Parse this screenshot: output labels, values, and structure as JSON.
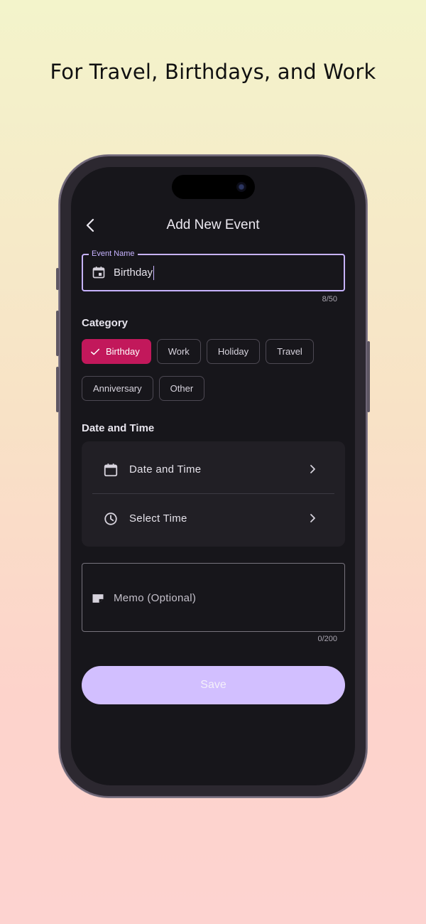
{
  "headline": "For Travel, Birthdays, and Work",
  "nav": {
    "title": "Add New Event",
    "back_icon": "chevron-left-icon"
  },
  "event_name": {
    "label": "Event Name",
    "value": "Birthday",
    "counter": "8/50",
    "icon": "calendar-event-icon"
  },
  "category": {
    "label": "Category",
    "chips": [
      {
        "label": "Birthday",
        "selected": true
      },
      {
        "label": "Work",
        "selected": false
      },
      {
        "label": "Holiday",
        "selected": false
      },
      {
        "label": "Travel",
        "selected": false
      },
      {
        "label": "Anniversary",
        "selected": false
      },
      {
        "label": "Other",
        "selected": false
      }
    ]
  },
  "date_time": {
    "label": "Date and Time",
    "rows": [
      {
        "label": "Date and Time",
        "icon": "calendar-icon"
      },
      {
        "label": "Select Time",
        "icon": "clock-icon"
      }
    ]
  },
  "memo": {
    "placeholder": "Memo (Optional)",
    "counter": "0/200",
    "icon": "note-icon"
  },
  "save_label": "Save",
  "colors": {
    "accent": "#c7b3ff",
    "selected_chip": "#c2185b",
    "save_button": "#d2bfff",
    "screen_bg": "#17161b"
  }
}
